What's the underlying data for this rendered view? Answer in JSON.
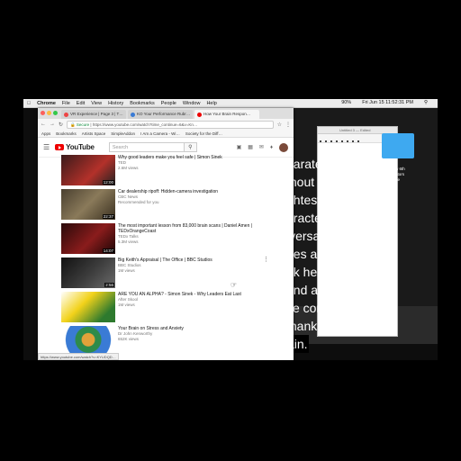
{
  "menubar": {
    "items": [
      "Chrome",
      "File",
      "Edit",
      "View",
      "History",
      "Bookmarks",
      "People",
      "Window",
      "Help"
    ],
    "clock": "Fri Jun 15 11:52:31 PM",
    "battery": "90%"
  },
  "browser": {
    "tabs": [
      {
        "label": "VR Experience | Page 3 | T…",
        "color": "#e44"
      },
      {
        "label": "KO Your Performance Rubr…",
        "color": "#3a7bd5"
      },
      {
        "label": "How Your Brain Respon…",
        "color": "#e00"
      }
    ],
    "url_secure": "Secure",
    "url": "https://www.youtube.com/watch?time_continue=6&v=Kn…",
    "bookmarks": [
      "Apps",
      "Bookmarks",
      "Artists Space",
      "SimpleAddon",
      "I Am a Camera - Wi…",
      "Society for the Diff…"
    ],
    "status_url": "https://www.youtube.com/watch?v=KYUDQD…"
  },
  "youtube": {
    "logo": "YouTube",
    "search_placeholder": "Search"
  },
  "videos": [
    {
      "title": "Why good leaders make you feel safe | Simon Sinek",
      "channel": "TED",
      "stats": "2.6M views",
      "duration": "12:00",
      "thumb": "#b3312a"
    },
    {
      "title": "Car dealership ripoff: Hidden-camera investigation",
      "channel": "CBC News",
      "stats": "Recommended for you",
      "duration": "22:37",
      "thumb": "#6b5a3a"
    },
    {
      "title": "The most important lesson from 83,000 brain scans | Daniel Amen | TEDxOrangeCoast",
      "channel": "TEDx Talks",
      "stats": "5.3M views",
      "duration": "14:07",
      "thumb": "#8a1c1c"
    },
    {
      "title": "Big Keith's Appraisal | The Office | BBC Studios",
      "channel": "BBC Studios",
      "stats": "1M views",
      "duration": "2:56",
      "thumb": "#3a3a3a"
    },
    {
      "title": "ARE YOU AN ALPHA? - Simon Sinek - Why Leaders Eat Last",
      "channel": "After Skool",
      "stats": "1M views",
      "duration": "",
      "thumb": "#f2d21a"
    },
    {
      "title": "Your Brain on Stress and Anxiety",
      "channel": "Dr John Kenworthy",
      "stats": "652K views",
      "duration": "",
      "thumb": "#2e8b4a"
    }
  ],
  "editor": {
    "title": "Untitled 3 — Edited"
  },
  "lyrics": [
    "parately,",
    "thout the",
    "ghtest",
    "aracter of",
    "iversality.",
    "pes anyone",
    "nk he has",
    "und a psychic",
    "se common to",
    "mankind?",
    "ain."
  ],
  "video_caption": [
    "w 6th",
    "ators",
    "he"
  ]
}
